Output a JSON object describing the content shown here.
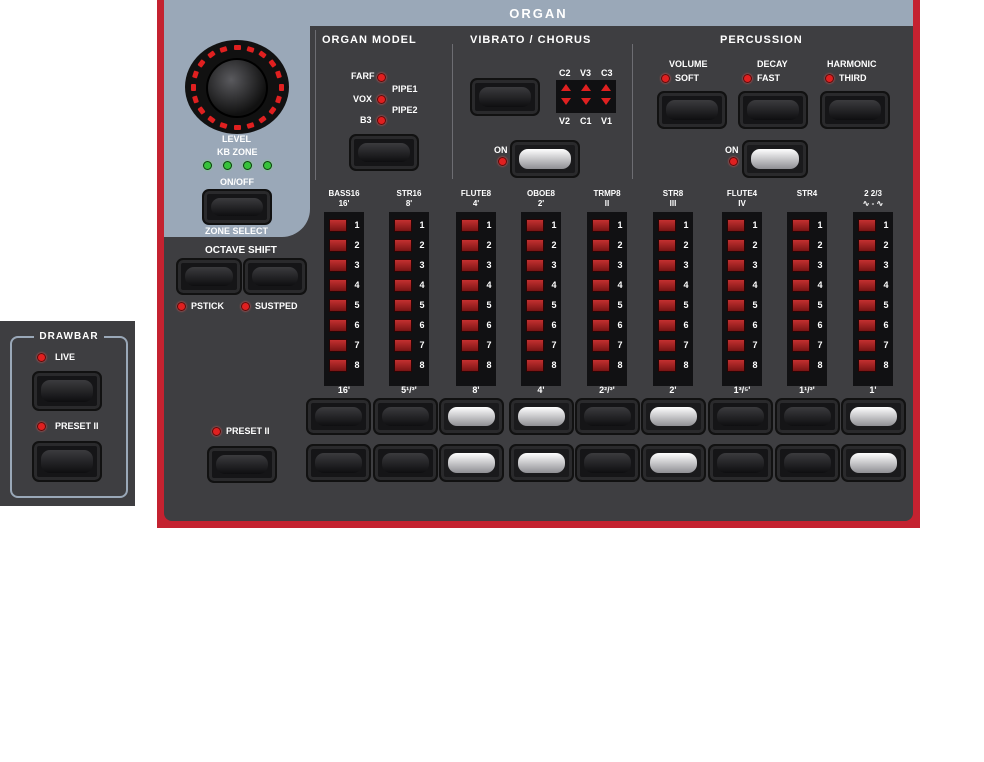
{
  "drawbar_panel": {
    "title": "DRAWBAR",
    "live_label": "LIVE",
    "preset_label": "PRESET II"
  },
  "organ": {
    "title": "ORGAN",
    "level": {
      "label": "LEVEL",
      "kb_zone_label": "KB ZONE",
      "on_off_label": "ON/OFF",
      "zone_select_label": "ZONE SELECT"
    },
    "octave_shift": {
      "title": "OCTAVE SHIFT",
      "pstick_label": "PSTICK",
      "sustped_label": "SUSTPED"
    },
    "preset_ii_label": "PRESET II",
    "organ_model": {
      "title": "ORGAN MODEL",
      "options_left": [
        "FARF",
        "VOX",
        "B3"
      ],
      "options_right": [
        "PIPE1",
        "PIPE2"
      ]
    },
    "vibrato": {
      "title": "VIBRATO / CHORUS",
      "top_labels": [
        "C2",
        "V3",
        "C3"
      ],
      "bottom_labels": [
        "V2",
        "C1",
        "V1"
      ],
      "on_label": "ON"
    },
    "percussion": {
      "title": "PERCUSSION",
      "volume_label": "VOLUME",
      "soft_label": "SOFT",
      "decay_label": "DECAY",
      "fast_label": "FAST",
      "harmonic_label": "HARMONIC",
      "third_label": "THIRD",
      "on_label": "ON"
    },
    "drawbars": [
      {
        "name": "BASS16",
        "sub": "16'",
        "foot": "16'"
      },
      {
        "name": "STR16",
        "sub": "8'",
        "foot": "5¹/³'"
      },
      {
        "name": "FLUTE8",
        "sub": "4'",
        "foot": "8'"
      },
      {
        "name": "OBOE8",
        "sub": "2'",
        "foot": "4'"
      },
      {
        "name": "TRMP8",
        "sub": "II",
        "foot": "2²/³'"
      },
      {
        "name": "STR8",
        "sub": "III",
        "foot": "2'"
      },
      {
        "name": "FLUTE4",
        "sub": "IV",
        "foot": "1³/⁵'"
      },
      {
        "name": "STR4",
        "sub": "",
        "foot": "1¹/³'"
      },
      {
        "name": "2 2/3",
        "sub": "∿ - ∿",
        "foot": "1'"
      }
    ],
    "steps": [
      "1",
      "2",
      "3",
      "4",
      "5",
      "6",
      "7",
      "8"
    ]
  },
  "colors": {
    "panel": "#3e3e41",
    "accent_red": "#c42230",
    "slate": "#9aa8b8",
    "led_red": "#e02020",
    "led_green": "#37c23b"
  }
}
